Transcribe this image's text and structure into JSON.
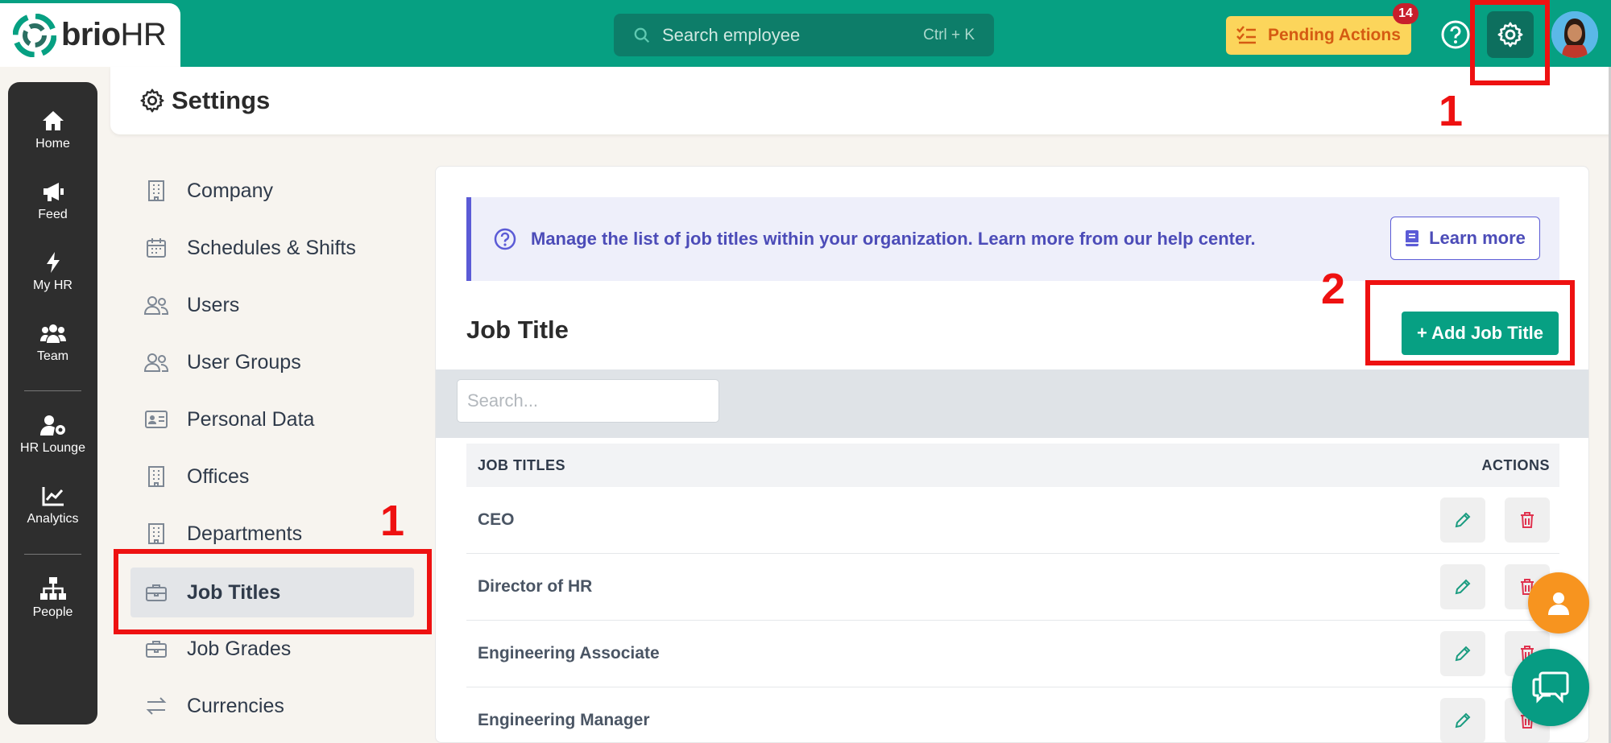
{
  "app": {
    "logo_text_a": "brio",
    "logo_text_b": "HR",
    "search_placeholder": "Search employee",
    "search_shortcut": "Ctrl + K",
    "pending_label": "Pending Actions",
    "pending_count": "14",
    "icons": {
      "search": "search-icon",
      "pending": "checklist-icon",
      "help": "help-circle-icon",
      "settings": "gear-icon",
      "avatar": "user-avatar"
    },
    "colors": {
      "brand": "#06a082",
      "pending_bg": "#fcd55b",
      "pending_text": "#d55b12",
      "badge": "#c81e2c",
      "accent": "#5b5bd6",
      "annotation": "#ee1111"
    }
  },
  "rail": {
    "items": [
      {
        "label": "Home",
        "icon": "home-icon"
      },
      {
        "label": "Feed",
        "icon": "megaphone-icon"
      },
      {
        "label": "My HR",
        "icon": "bolt-icon"
      },
      {
        "label": "Team",
        "icon": "users-icon"
      },
      {
        "label": "HR Lounge",
        "icon": "user-gear-icon"
      },
      {
        "label": "Analytics",
        "icon": "chart-line-icon"
      },
      {
        "label": "People",
        "icon": "org-chart-icon"
      }
    ]
  },
  "header": {
    "title": "Settings"
  },
  "settings_nav": {
    "items": [
      {
        "label": "Company",
        "icon": "building-icon"
      },
      {
        "label": "Schedules & Shifts",
        "icon": "calendar-icon"
      },
      {
        "label": "Users",
        "icon": "users-outline-icon"
      },
      {
        "label": "User Groups",
        "icon": "users-outline-icon"
      },
      {
        "label": "Personal Data",
        "icon": "id-card-icon"
      },
      {
        "label": "Offices",
        "icon": "building-icon"
      },
      {
        "label": "Departments",
        "icon": "building-icon"
      },
      {
        "label": "Job Titles",
        "icon": "briefcase-icon",
        "active": true
      },
      {
        "label": "Job Grades",
        "icon": "briefcase-icon"
      },
      {
        "label": "Currencies",
        "icon": "exchange-icon"
      }
    ]
  },
  "main": {
    "banner_text": "Manage the list of job titles within your organization. Learn more from our help center.",
    "learn_more_label": "Learn more",
    "section_title": "Job Title",
    "add_button_label": "+ Add Job Title",
    "search_placeholder": "Search...",
    "table": {
      "col_title": "JOB TITLES",
      "col_actions": "ACTIONS",
      "rows": [
        "CEO",
        "Director of HR",
        "Engineering Associate",
        "Engineering Manager"
      ]
    }
  },
  "annotations": {
    "nav_number": "1",
    "gear_number": "1",
    "add_number": "2"
  }
}
